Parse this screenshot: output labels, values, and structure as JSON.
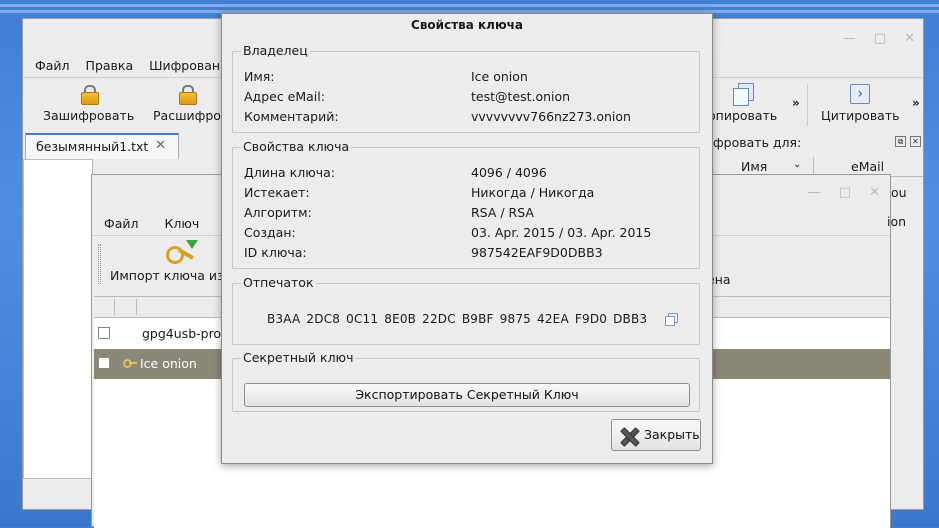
{
  "main_window": {
    "menu": [
      "Файл",
      "Правка",
      "Шифрован"
    ],
    "toolbar": {
      "encrypt": "Зашифровать",
      "decrypt": "Расшифро",
      "copy": "опировать",
      "quote": "Цитировать",
      "more": "»"
    },
    "tab": {
      "label": "безымянный1.txt",
      "close": "✕"
    },
    "encrypt_panel": {
      "title": "фровать для:",
      "col_name": "Имя",
      "col_email": "eMail",
      "row_fragment": "ion",
      "right_fragment": "ou"
    }
  },
  "key_manager": {
    "menu": [
      "Файл",
      "Ключ"
    ],
    "import_label": "Импорт ключа из",
    "fragment_right": "ена",
    "rows": [
      {
        "name": "gpg4usb-pro",
        "selected": false
      },
      {
        "name": "Ice onion",
        "selected": true
      }
    ]
  },
  "dialog": {
    "title": "Свойства ключа",
    "owner": {
      "title": "Владелец",
      "name_label": "Имя:",
      "name_value": "Ice onion",
      "email_label": "Адрес eMail:",
      "email_value": "test@test.onion",
      "comment_label": "Комментарий:",
      "comment_value": "vvvvvvvv766nz273.onion"
    },
    "props": {
      "title": "Свойства ключа",
      "length_label": "Длина ключа:",
      "length_value": "4096 / 4096",
      "expires_label": "Истекает:",
      "expires_value": "Никогда / Никогда",
      "algo_label": "Алгоритм:",
      "algo_value": "RSA / RSA",
      "created_label": "Создан:",
      "created_value": "03. Apr. 2015 / 03. Apr. 2015",
      "id_label": "ID ключа:",
      "id_value": "987542EAF9D0DBB3"
    },
    "fingerprint": {
      "title": "Отпечаток",
      "value": "B3AA 2DC8 0C11 8E0B 22DC B9BF 9875 42EA F9D0 DBB3"
    },
    "secret": {
      "title": "Секретный ключ",
      "export_label": "Экспортировать Секретный Ключ"
    },
    "close_label": "Закрыть"
  },
  "colors": {
    "desktop": "#4f8fe0",
    "selection": "#8c8878",
    "tab_accent": "#4a78c8"
  }
}
